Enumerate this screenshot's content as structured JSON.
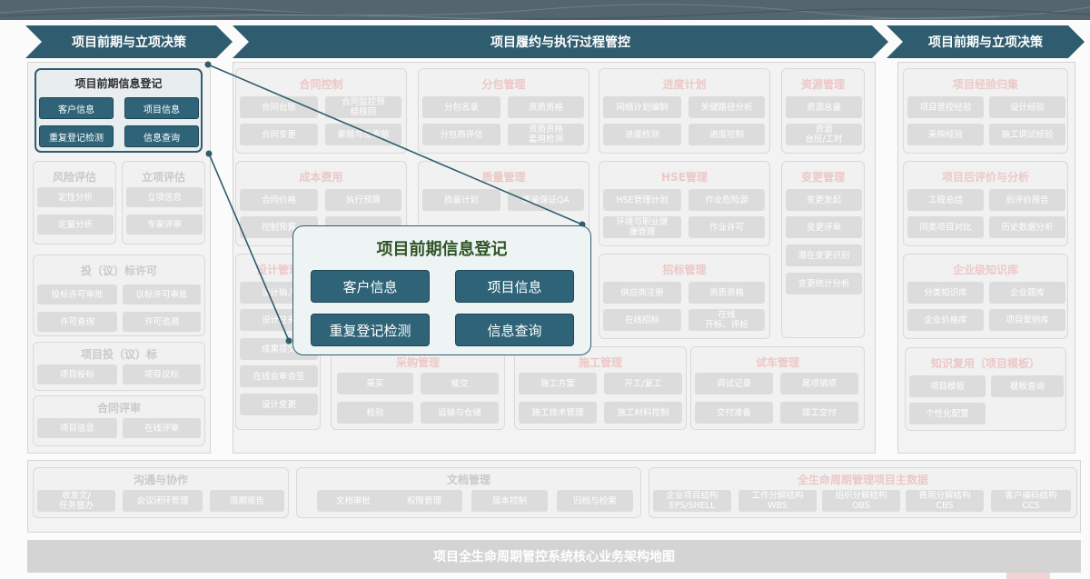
{
  "top_arrows": [
    "项目前期与立项决策",
    "项目履约与执行过程管控",
    "项目前期与立项决策"
  ],
  "highlight": {
    "title": "项目前期信息登记",
    "buttons": [
      "客户信息",
      "项目信息",
      "重复登记检测",
      "信息查询"
    ]
  },
  "popup": {
    "title": "项目前期信息登记",
    "buttons": [
      "客户信息",
      "项目信息",
      "重复登记检测",
      "信息查询"
    ]
  },
  "footer": "项目全生命周期管控系统核心业务架构地图",
  "left": [
    {
      "title": "风险评估",
      "items": [
        "定性分析",
        "定量分析"
      ]
    },
    {
      "title": "立项评估",
      "items": [
        "立项信息",
        "专家评审"
      ]
    },
    {
      "title": "投（议）标许可",
      "items": [
        "投标许可审批",
        "议标许可审批",
        "许可查询",
        "许可追溯"
      ]
    },
    {
      "title": "项目投（议）标",
      "items": [
        "项目投标",
        "项目议标"
      ]
    },
    {
      "title": "合同评审",
      "items": [
        "项目信息",
        "在线评审"
      ]
    }
  ],
  "middle": [
    {
      "title": "合同控制",
      "items": [
        "合同台账",
        "合同监控预\n结核回",
        "合同变更",
        "索赔与反索赔"
      ]
    },
    {
      "title": "分包管理",
      "items": [
        "分包名录",
        "资质资格",
        "分包商评估",
        "资质资格\n套用检测"
      ]
    },
    {
      "title": "进度计划",
      "items": [
        "网络计划编制",
        "关键路径分析",
        "进度检测",
        "进度控制"
      ]
    },
    {
      "title": "资源管理",
      "items": [
        "资源总量",
        "资源\n台班/工时"
      ]
    },
    {
      "title": "成本费用",
      "items": [
        "合同价格",
        "执行预算",
        "控制预算",
        ""
      ]
    },
    {
      "title": "质量管理",
      "items": [
        "质量计划",
        "质量保证QA"
      ]
    },
    {
      "title": "HSE管理",
      "items": [
        "HSE管理计划",
        "作业危险源",
        "环境与职业健\n康管理",
        "作业许可"
      ]
    },
    {
      "title": "变更管理",
      "items": [
        "变更发起",
        "变更评审",
        "潜在变更识别",
        "变更统计分析"
      ]
    },
    {
      "title": "设计管理",
      "items": [
        "设计输入",
        "设计往来",
        "成果提交",
        "在线会审会签",
        "设计变更"
      ]
    },
    {
      "title": "招标管理",
      "items": [
        "供应商注册",
        "资质资格",
        "在线招标",
        "在线\n开标、评标"
      ]
    },
    {
      "title": "采购管理",
      "items": [
        "采买",
        "催交",
        "检验",
        "运输与仓储"
      ]
    },
    {
      "title": "施工管理",
      "items": [
        "施工方案",
        "开工/复工",
        "施工技术管理",
        "施工材料控制"
      ]
    },
    {
      "title": "试车管理",
      "items": [
        "调试记录",
        "尾项销项",
        "交付准备",
        "竣工交付"
      ]
    }
  ],
  "right": [
    {
      "title": "项目经验归集",
      "items": [
        "项目管控经验",
        "设计经验",
        "采购经验",
        "施工调试经验"
      ]
    },
    {
      "title": "项目后评价与分析",
      "items": [
        "工程总结",
        "后评价报告",
        "同类项目对比",
        "历史数据分析"
      ]
    },
    {
      "title": "企业级知识库",
      "items": [
        "分类知识库",
        "企业题库",
        "企业价格库",
        "项目案例库"
      ]
    },
    {
      "title": "知识复用（项目模板）",
      "items": [
        "项目模板",
        "模板查询",
        "个性化配置"
      ]
    }
  ],
  "bottom": [
    {
      "title": "沟通与协作",
      "items": [
        "收发文/\n任务督办",
        "会议闭环管理",
        "周期报告"
      ]
    },
    {
      "title": "文档管理",
      "items": [
        "文档审批",
        "权限管理",
        "版本控制",
        "归档与检索"
      ]
    },
    {
      "title": "全生命周期管理项目主数据",
      "items": [
        "企业项目结构\nEPS/SHELL",
        "工作分解结构\nWBS",
        "组织分解结构\nOBS",
        "费用分解结构\nCBS",
        "客户编码结构\nCCS"
      ]
    }
  ]
}
